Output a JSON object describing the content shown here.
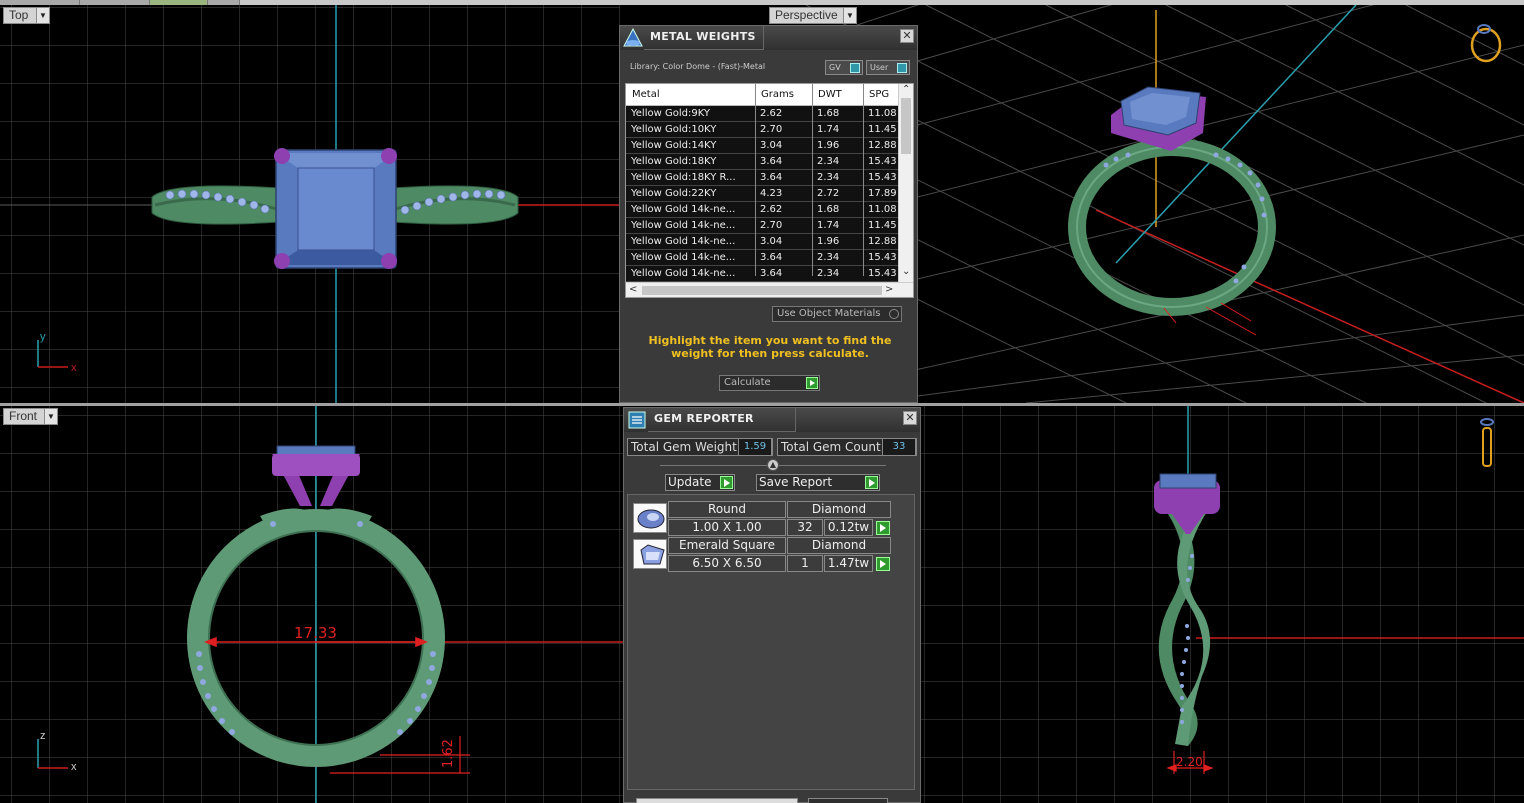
{
  "viewports": {
    "top": {
      "label": "Top"
    },
    "perspective": {
      "label": "Perspective"
    },
    "front": {
      "label": "Front"
    }
  },
  "axes": {
    "top_y": "y",
    "top_x": "x",
    "front_z": "z",
    "front_x": "x"
  },
  "dimensions": {
    "inner_diameter": "17.33",
    "shank_height": "1.62",
    "shank_width": "2.20"
  },
  "metal_weights": {
    "title": "METAL WEIGHTS",
    "library": "Library: Color Dome - (Fast)-Metal",
    "gv_label": "GV",
    "user_label": "User",
    "columns": [
      "Metal",
      "Grams",
      "DWT",
      "SPG"
    ],
    "rows": [
      [
        "Yellow Gold:9KY",
        "2.62",
        "1.68",
        "11.08"
      ],
      [
        "Yellow Gold:10KY",
        "2.70",
        "1.74",
        "11.45"
      ],
      [
        "Yellow Gold:14KY",
        "3.04",
        "1.96",
        "12.88"
      ],
      [
        "Yellow Gold:18KY",
        "3.64",
        "2.34",
        "15.43"
      ],
      [
        "Yellow Gold:18KY R...",
        "3.64",
        "2.34",
        "15.43"
      ],
      [
        "Yellow Gold:22KY",
        "4.23",
        "2.72",
        "17.89"
      ],
      [
        "Yellow Gold 14k-ne...",
        "2.62",
        "1.68",
        "11.08"
      ],
      [
        "Yellow Gold 14k-ne...",
        "2.70",
        "1.74",
        "11.45"
      ],
      [
        "Yellow Gold 14k-ne...",
        "3.04",
        "1.96",
        "12.88"
      ],
      [
        "Yellow Gold 14k-ne...",
        "3.64",
        "2.34",
        "15.43"
      ],
      [
        "Yellow Gold 14k-ne...",
        "3.64",
        "2.34",
        "15.43"
      ]
    ],
    "use_object_materials": "Use Object Materials",
    "note": "Highlight the item you want to find the weight for then press calculate.",
    "calculate": "Calculate"
  },
  "gem_reporter": {
    "title": "GEM REPORTER",
    "total_weight_label": "Total Gem Weight",
    "total_weight_value": "1.59",
    "total_count_label": "Total Gem Count",
    "total_count_value": "33",
    "update_label": "Update",
    "save_report_label": "Save Report",
    "gems": [
      {
        "shape": "Round",
        "material": "Diamond",
        "size": "1.00 X 1.00",
        "count": "32",
        "weight": "0.12tw"
      },
      {
        "shape": "Emerald Square",
        "material": "Diamond",
        "size": "6.50 X 6.50",
        "count": "1",
        "weight": "1.47tw"
      }
    ]
  },
  "colors": {
    "metal": "#4e8a64",
    "prong": "#8e3fb0",
    "stone": "#5a7ac0",
    "grid": "#505050",
    "axis_red": "#c81e1e",
    "axis_cyan": "#2aa0b0",
    "dimension": "#e02020",
    "note_yellow": "#f0c020"
  }
}
